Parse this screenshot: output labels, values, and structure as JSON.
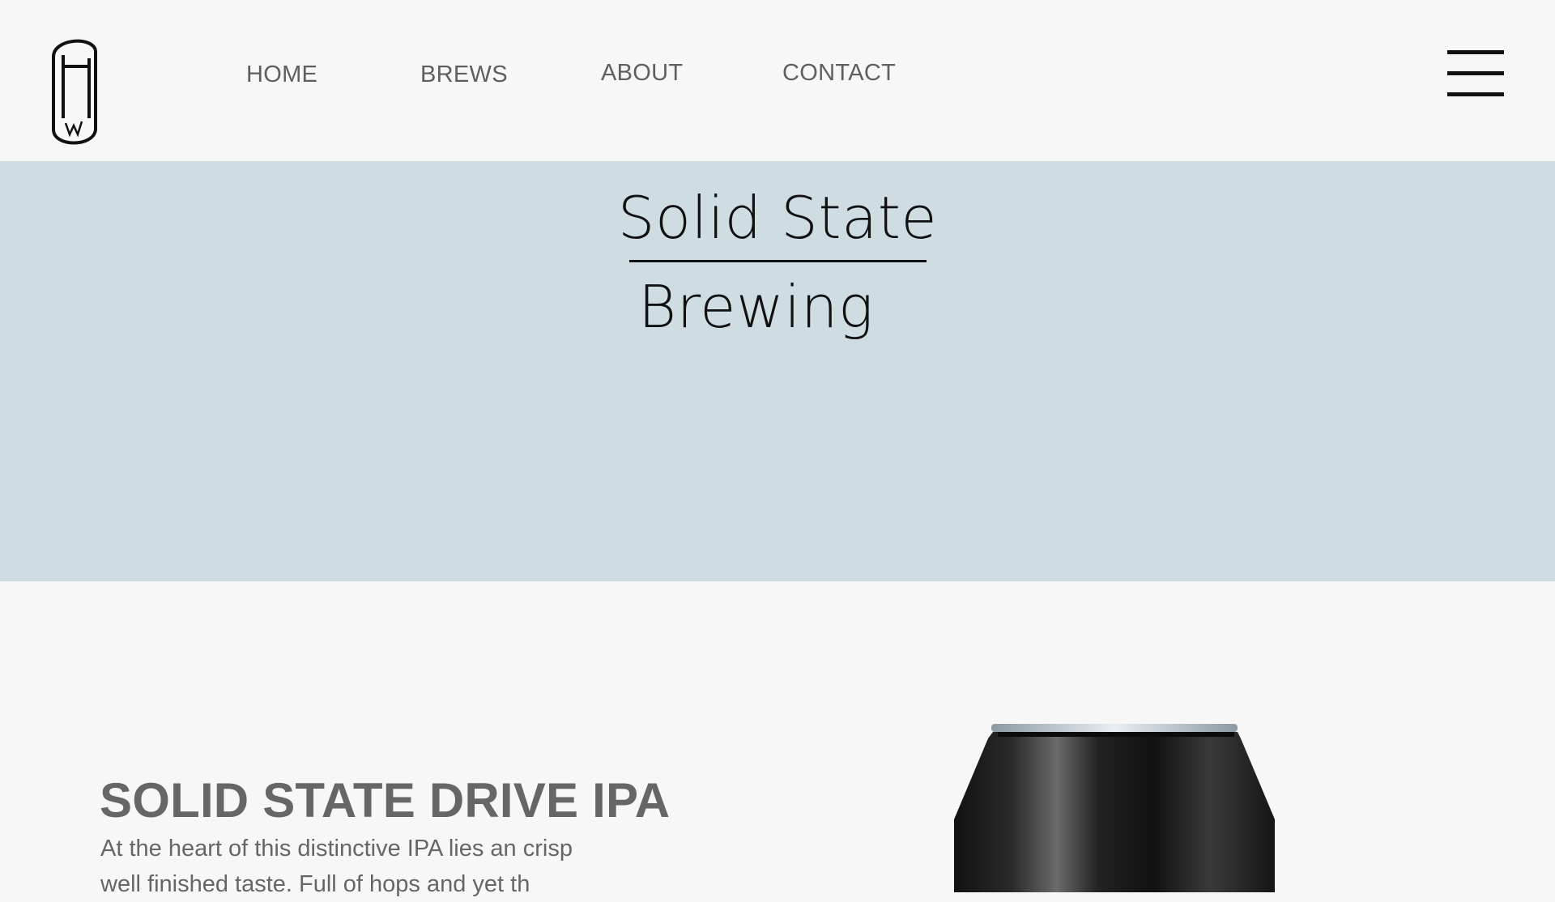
{
  "header": {
    "logo_icon": "beer-glass-logo-icon",
    "nav": [
      {
        "label": "HOME"
      },
      {
        "label": "BREWS"
      },
      {
        "label": "ABOUT"
      },
      {
        "label": "CONTACT"
      }
    ],
    "menu_icon": "hamburger-menu-icon"
  },
  "hero": {
    "title_line1": "Solid State",
    "title_line2": "Brewing",
    "background": "#cfdde3"
  },
  "feature": {
    "name": "SOLID STATE DRIVE IPA",
    "description": "At the heart of this distinctive IPA lies an crisp well finished taste. Full of hops and yet th",
    "image_icon": "beer-can-image"
  }
}
